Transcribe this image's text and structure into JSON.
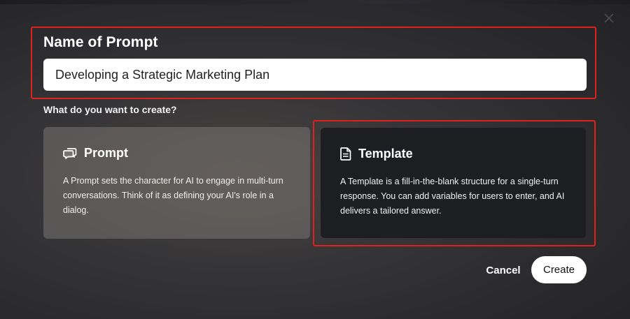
{
  "dialog": {
    "name_title": "Name of Prompt",
    "name_value": "Developing a Strategic Marketing Plan",
    "question": "What do you want to create?",
    "close_icon": "close-icon"
  },
  "cards": [
    {
      "icon": "chat-bubbles-icon",
      "title": "Prompt",
      "description": "A Prompt sets the character for AI to engage in multi-turn conversations. Think of it as defining your AI's role in a dialog."
    },
    {
      "icon": "document-icon",
      "title": "Template",
      "description": "A Template is a fill-in-the-blank structure for a single-turn response. You can add variables for users to enter, and AI delivers a tailored answer."
    }
  ],
  "actions": {
    "cancel_label": "Cancel",
    "create_label": "Create"
  },
  "colors": {
    "highlight": "#e0211b",
    "selected_card_bg": "#1d1e22",
    "unselected_card_bg": "#6f6b69"
  }
}
